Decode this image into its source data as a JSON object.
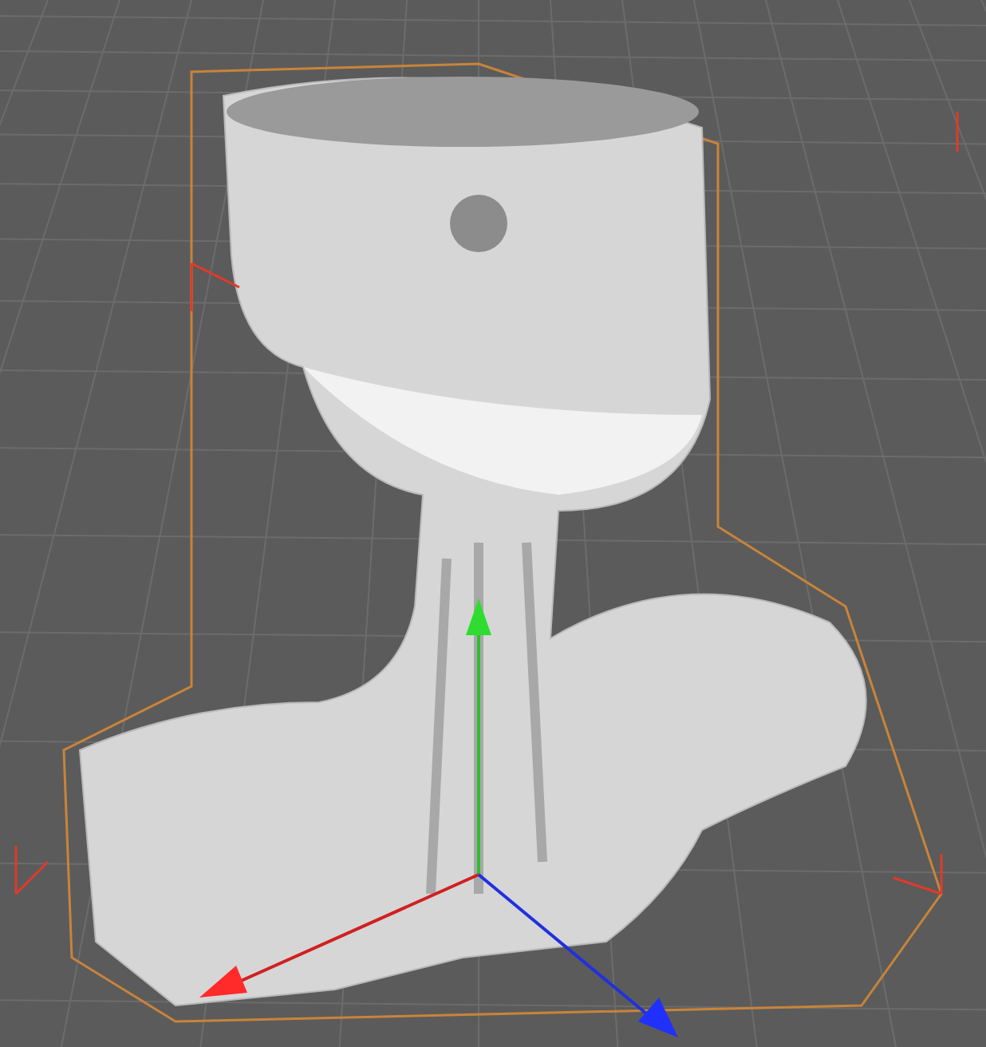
{
  "viewport": {
    "show_grid": true,
    "show_axis_gizmo": true,
    "show_bounding_box": true
  }
}
